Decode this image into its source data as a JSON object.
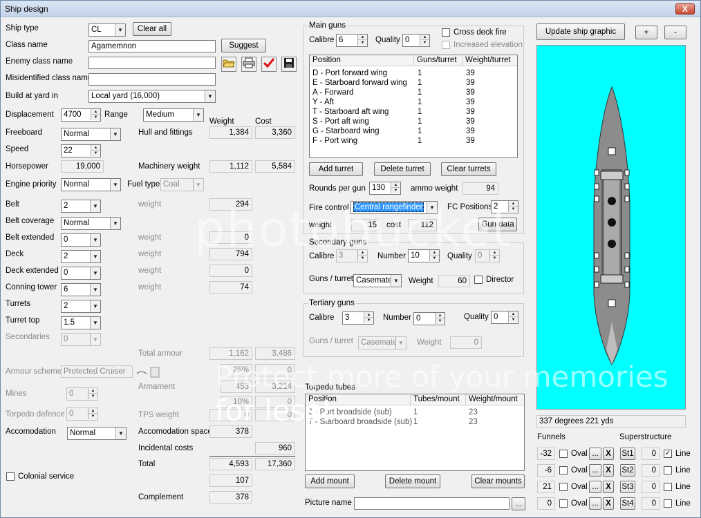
{
  "window": {
    "title": "Ship design",
    "close": "X"
  },
  "left": {
    "ship_type_label": "Ship type",
    "ship_type": "CL",
    "clear_all": "Clear all",
    "class_name_label": "Class name",
    "class_name": "Agamemnon",
    "suggest": "Suggest",
    "enemy_class_label": "Enemy class name",
    "enemy_class": "",
    "misid_label": "Misidentified class name",
    "misid": "",
    "yard_label": "Build at yard in",
    "yard": "Local yard (16,000)",
    "displacement_label": "Displacement",
    "displacement": "4700",
    "range_label": "Range",
    "range": "Medium",
    "weight_hdr": "Weight",
    "cost_hdr": "Cost",
    "freeboard_label": "Freeboard",
    "freeboard": "Normal",
    "hull_label": "Hull and fittings",
    "hull_weight": "1,384",
    "hull_cost": "3,360",
    "speed_label": "Speed",
    "speed": "22",
    "hp_label": "Horsepower",
    "hp": "19,000",
    "mach_label": "Machinery weight",
    "mach_weight": "1,112",
    "mach_cost": "5,584",
    "engine_label": "Engine priority",
    "engine": "Normal",
    "fuel_label": "Fuel type",
    "fuel": "Coal",
    "belt_label": "Belt",
    "belt": "2",
    "belt_w_label": "weight",
    "belt_weight": "294",
    "belt_cov_label": "Belt coverage",
    "belt_cov": "Normal",
    "belt_ext_label": "Belt extended",
    "belt_ext": "0",
    "belt_ext_w_label": "weight",
    "belt_ext_weight": "0",
    "deck_label": "Deck",
    "deck": "2",
    "deck_w_label": "weight",
    "deck_weight": "794",
    "deck_ext_label": "Deck extended",
    "deck_ext": "0",
    "deck_ext_w_label": "weight",
    "deck_ext_weight": "0",
    "ct_label": "Conning tower",
    "ct": "6",
    "ct_w_label": "weight",
    "ct_weight": "74",
    "turrets_label": "Turrets",
    "turrets": "2",
    "turret_top_label": "Turret top",
    "turret_top": "1.5",
    "secondaries_label": "Secondaries",
    "secondaries": "0",
    "total_armour_label": "Total armour",
    "total_armour_w": "1,162",
    "total_armour_c": "3,486",
    "armour_scheme_label": "Armour scheme",
    "armour_scheme": "Protected Cruiser",
    "pct1": "25%",
    "pct1_c": "0",
    "mines_label": "Mines",
    "mines": "0",
    "armament_label": "Armament",
    "armament_w": "453",
    "armament_c": "3,214",
    "pct2": "10%",
    "pct2_c": "0",
    "torp_def_label": "Torpedo defence",
    "torp_def": "0",
    "tps_label": "TPS weight",
    "tps_w": "0",
    "tps_c": "0",
    "accom_label": "Accomodation",
    "accom": "Normal",
    "accom_space_label": "Accomodation space",
    "accom_space": "378",
    "incidental_label": "Incidental costs",
    "incidental": "960",
    "total_label": "Total",
    "total_w": "4,593",
    "total_c": "17,360",
    "extra": "107",
    "colonial_label": "Colonial service",
    "complement_label": "Complement",
    "complement": "378"
  },
  "main_guns": {
    "title": "Main guns",
    "calibre_label": "Calibre",
    "calibre": "6",
    "quality_label": "Quality",
    "quality": "0",
    "cross_deck": "Cross deck fire",
    "inc_elev": "Increased elevation",
    "headers": [
      "Position",
      "Guns/turret",
      "Weight/turret"
    ],
    "rows": [
      [
        "D - Port forward wing",
        "1",
        "39"
      ],
      [
        "E - Starboard forward wing",
        "1",
        "39"
      ],
      [
        "A - Forward",
        "1",
        "39"
      ],
      [
        "Y - Aft",
        "1",
        "39"
      ],
      [
        "T - Starboard aft wing",
        "1",
        "39"
      ],
      [
        "S - Port aft wing",
        "1",
        "39"
      ],
      [
        "G - Starboard wing",
        "1",
        "39"
      ],
      [
        "F - Port wing",
        "1",
        "39"
      ]
    ],
    "add": "Add turret",
    "delete": "Delete turret",
    "clear": "Clear turrets",
    "rounds_label": "Rounds per gun",
    "rounds": "130",
    "ammo_label": "ammo weight",
    "ammo": "94",
    "fire_label": "Fire control",
    "fire": "Central rangefinder",
    "fc_label": "FC Positions",
    "fc": "2",
    "weight_label": "weight",
    "weight": "15",
    "cost_label": "cost",
    "cost": "112",
    "gun_data": "Gun data"
  },
  "secondary": {
    "title": "Secondary guns",
    "calibre_label": "Calibre",
    "calibre": "3",
    "number_label": "Number",
    "number": "10",
    "quality_label": "Quality",
    "quality": "0",
    "gt_label": "Guns / turret",
    "gt": "Casemate",
    "weight_label": "Weight",
    "weight": "60",
    "director": "Director"
  },
  "tertiary": {
    "title": "Tertiary guns",
    "calibre_label": "Calibre",
    "calibre": "3",
    "number_label": "Number",
    "number": "0",
    "quality_label": "Quality",
    "quality": "0",
    "gt_label": "Guns / turret",
    "gt": "Casemate",
    "weight_label": "Weight",
    "weight": "0"
  },
  "torpedo": {
    "title": "Torpedo tubes",
    "headers": [
      "Position",
      "Tubes/mount",
      "Weight/mount"
    ],
    "rows": [
      [
        "6 - Port broadside (sub)",
        "1",
        "23"
      ],
      [
        "7 - Starboard broadside (sub)",
        "1",
        "23"
      ]
    ],
    "add": "Add mount",
    "delete": "Delete mount",
    "clear": "Clear mounts",
    "picture_label": "Picture name",
    "picture": "",
    "browse": "..."
  },
  "right": {
    "update": "Update ship graphic",
    "plus": "+",
    "minus": "-",
    "status": "337 degrees 221 yds",
    "funnels_label": "Funnels",
    "super_label": "Superstructure",
    "funnels": [
      {
        "v": "-32",
        "oval": "Oval",
        "b": "...",
        "x": "X"
      },
      {
        "v": "-6",
        "oval": "Oval",
        "b": "...",
        "x": "X"
      },
      {
        "v": "21",
        "oval": "Oval",
        "b": "...",
        "x": "X"
      },
      {
        "v": "0",
        "oval": "Oval",
        "b": "...",
        "x": "X"
      }
    ],
    "supers": [
      {
        "btn": "St1",
        "v": "0",
        "line": "Line",
        "checked": true
      },
      {
        "btn": "St2",
        "v": "0",
        "line": "Line",
        "checked": false
      },
      {
        "btn": "St3",
        "v": "0",
        "line": "Line",
        "checked": false
      },
      {
        "btn": "St4",
        "v": "0",
        "line": "Line",
        "checked": false
      }
    ]
  },
  "watermark": {
    "text": "photobucket",
    "text2": "Protect more of your memories",
    "text3": "for less!"
  },
  "colors": {
    "ship_bg": "#00ffff",
    "hull": "#8c8c8c",
    "selection": "#3399ff"
  }
}
